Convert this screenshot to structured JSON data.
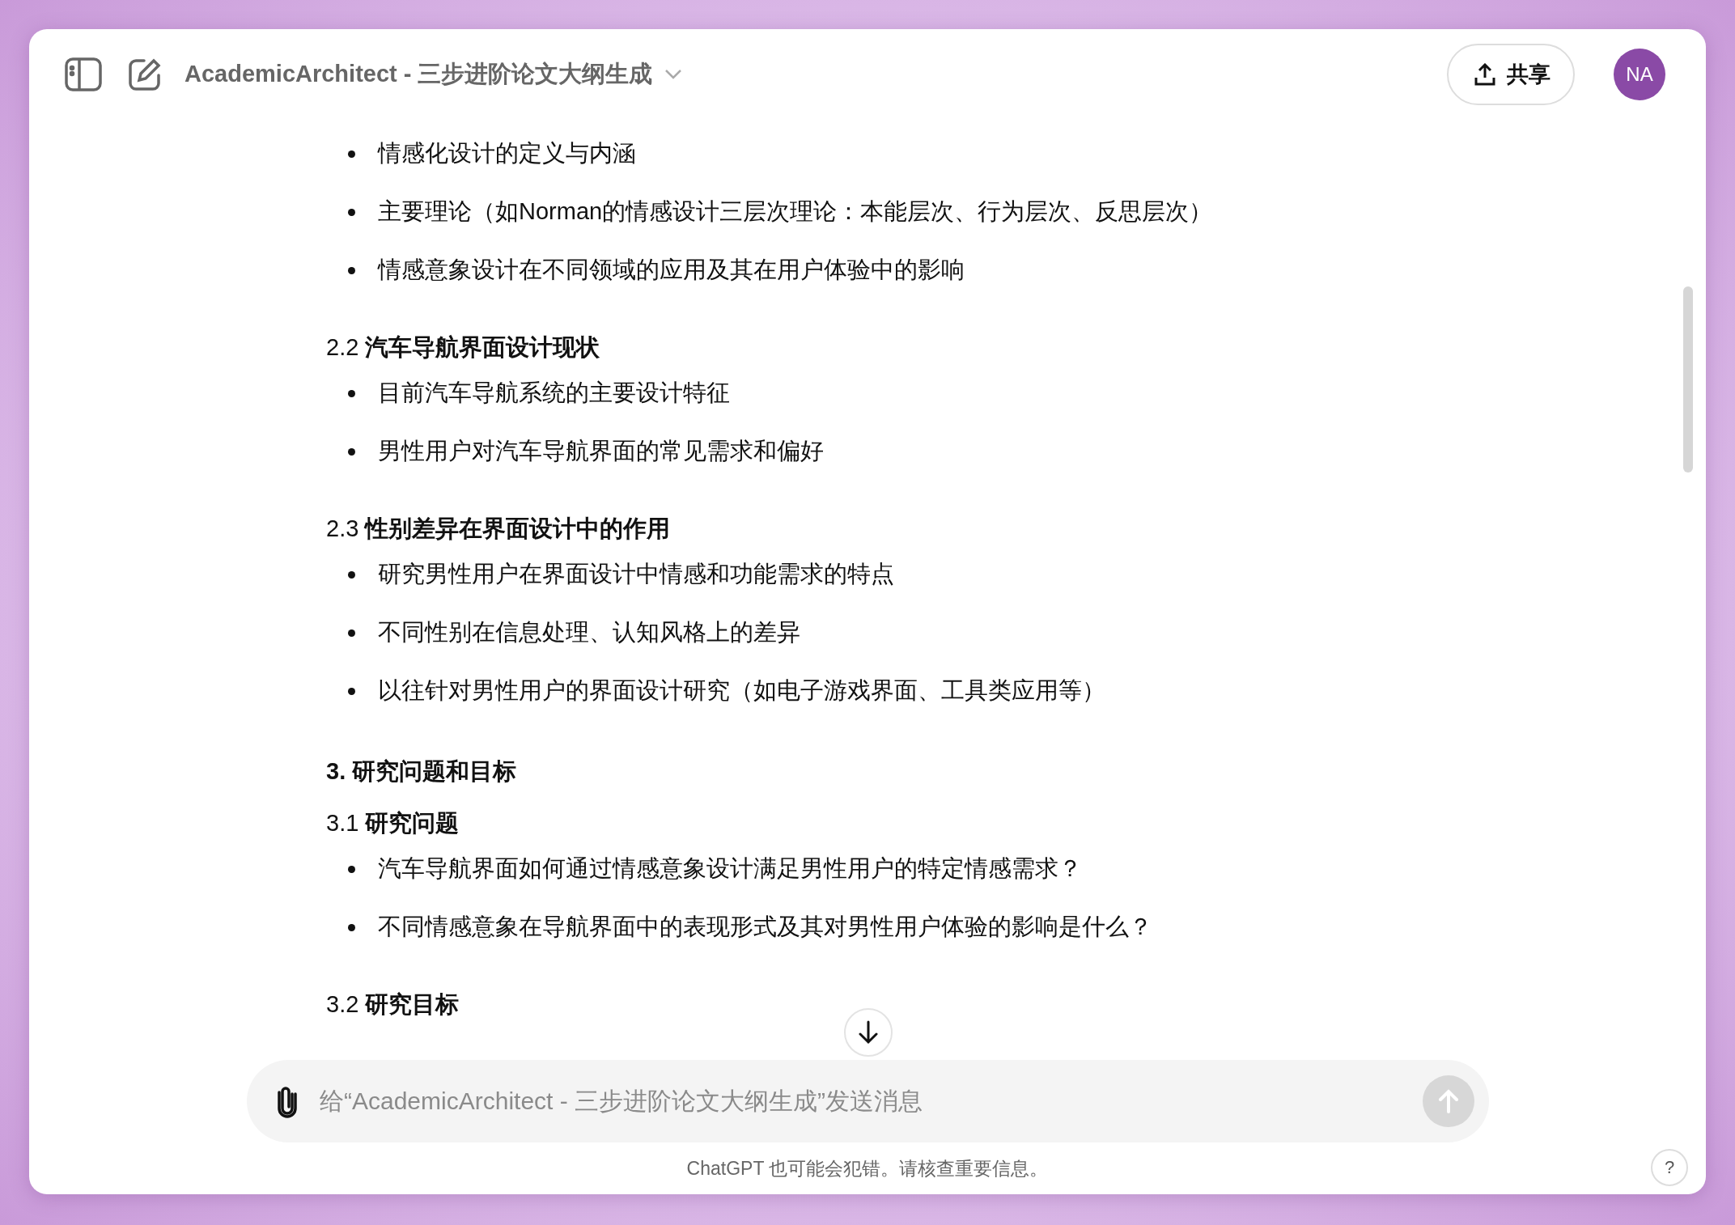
{
  "header": {
    "title": "AcademicArchitect - 三步进阶论文大纲生成",
    "share_label": "共享",
    "avatar": "NA"
  },
  "blocks": [
    {
      "kind": "bullet",
      "text": "情感化设计的定义与内涵"
    },
    {
      "kind": "bullet",
      "text": "主要理论（如Norman的情感设计三层次理论：本能层次、行为层次、反思层次）"
    },
    {
      "kind": "bullet",
      "text": "情感意象设计在不同领域的应用及其在用户体验中的影响"
    },
    {
      "kind": "subheading",
      "text": "2.2 **汽车导航界面设计现状**"
    },
    {
      "kind": "bullet",
      "text": "目前汽车导航系统的主要设计特征"
    },
    {
      "kind": "bullet",
      "text": "男性用户对汽车导航界面的常见需求和偏好"
    },
    {
      "kind": "subheading",
      "text": "2.3 **性别差异在界面设计中的作用**"
    },
    {
      "kind": "bullet",
      "text": "研究男性用户在界面设计中情感和功能需求的特点"
    },
    {
      "kind": "bullet",
      "text": "不同性别在信息处理、认知风格上的差异"
    },
    {
      "kind": "bullet",
      "text": "以往针对男性用户的界面设计研究（如电子游戏界面、工具类应用等）"
    },
    {
      "kind": "heading",
      "text": "3. 研究问题和目标"
    },
    {
      "kind": "subheading",
      "text": "3.1 **研究问题**"
    },
    {
      "kind": "bullet",
      "text": "汽车导航界面如何通过情感意象设计满足男性用户的特定情感需求？"
    },
    {
      "kind": "bullet",
      "text": "不同情感意象在导航界面中的表现形式及其对男性用户体验的影响是什么？"
    },
    {
      "kind": "subheading",
      "text": "3.2 **研究目标**"
    }
  ],
  "composer": {
    "placeholder": "给“AcademicArchitect - 三步进阶论文大纲生成”发送消息"
  },
  "footer": "ChatGPT 也可能会犯错。请核查重要信息。",
  "help": "?"
}
